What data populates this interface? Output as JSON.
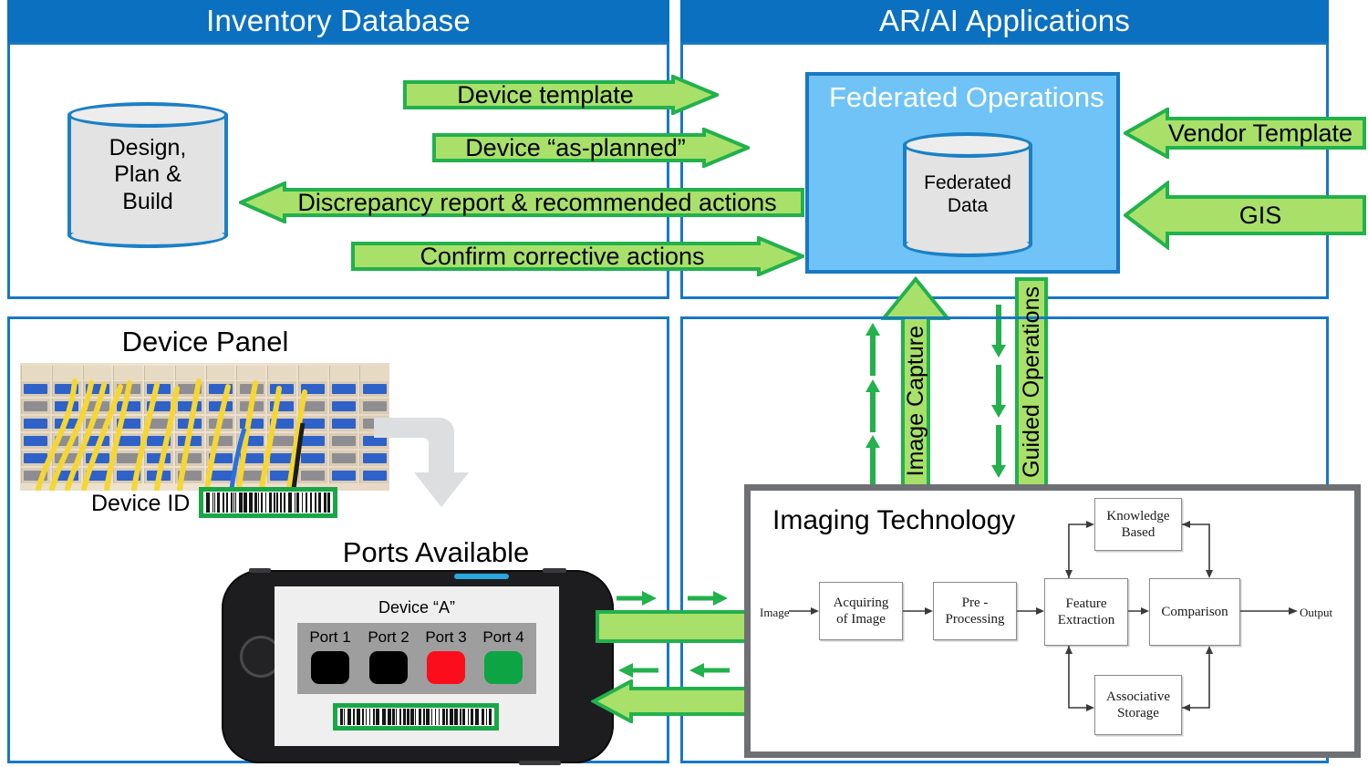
{
  "panels": {
    "inventory": {
      "title": "Inventory Database"
    },
    "arai": {
      "title": "AR/AI Applications"
    }
  },
  "inventory": {
    "database_cylinder": {
      "line1": "Design,",
      "line2": "Plan &",
      "line3": "Build"
    },
    "flows": [
      {
        "label": "Device template",
        "direction": "right"
      },
      {
        "label": "Device “as-planned”",
        "direction": "right"
      },
      {
        "label": "Discrepancy report & recommended actions",
        "direction": "left"
      },
      {
        "label": "Confirm corrective actions",
        "direction": "right"
      }
    ]
  },
  "arai": {
    "federated_operations": {
      "title": "Federated Operations",
      "cylinder": {
        "line1": "Federated",
        "line2": "Data"
      }
    },
    "inputs": [
      {
        "label": "Vendor Template",
        "direction": "left"
      },
      {
        "label": "GIS",
        "direction": "left"
      }
    ],
    "vertical_flows": [
      {
        "label": "Image Capture",
        "direction": "up"
      },
      {
        "label": "Guided Operations",
        "direction": "down"
      }
    ]
  },
  "device_panel": {
    "title": "Device Panel",
    "device_id_label": "Device ID",
    "barcode_name": "device-id-barcode"
  },
  "ports_available": {
    "title": "Ports Available",
    "device_name": "Device “A”",
    "ports": [
      {
        "label": "Port 1",
        "color": "#000000",
        "state": "unknown"
      },
      {
        "label": "Port 2",
        "color": "#000000",
        "state": "unknown"
      },
      {
        "label": "Port 3",
        "color": "#FC0D1B",
        "state": "occupied"
      },
      {
        "label": "Port 4",
        "color": "#0DA443",
        "state": "available"
      }
    ],
    "barcode_name": "device-a-barcode"
  },
  "imaging": {
    "title": "Imaging Technology",
    "input_label": "Image",
    "output_label": "Output",
    "blocks": [
      {
        "id": "acquiring",
        "line1": "Acquiring",
        "line2": "of Image"
      },
      {
        "id": "preprocessing",
        "line1": "Pre -",
        "line2": "Processing"
      },
      {
        "id": "feature",
        "line1": "Feature",
        "line2": "Extraction"
      },
      {
        "id": "comparison",
        "line1": "Comparison",
        "line2": ""
      },
      {
        "id": "knowledge",
        "line1": "Knowledge",
        "line2": "Based"
      },
      {
        "id": "associative",
        "line1": "Associative",
        "line2": "Storage"
      }
    ]
  },
  "colors": {
    "header_blue": "#0C70C0",
    "panel_border_blue": "#1878C4",
    "fed_ops_fill": "#6FC3F7",
    "arrow_fill": "#A8E06A",
    "arrow_stroke": "#22B14C",
    "cylinder_fill": "#E3E3E3",
    "imaging_border": "#6E7074",
    "gray_elbow": "#DCDEE0"
  }
}
